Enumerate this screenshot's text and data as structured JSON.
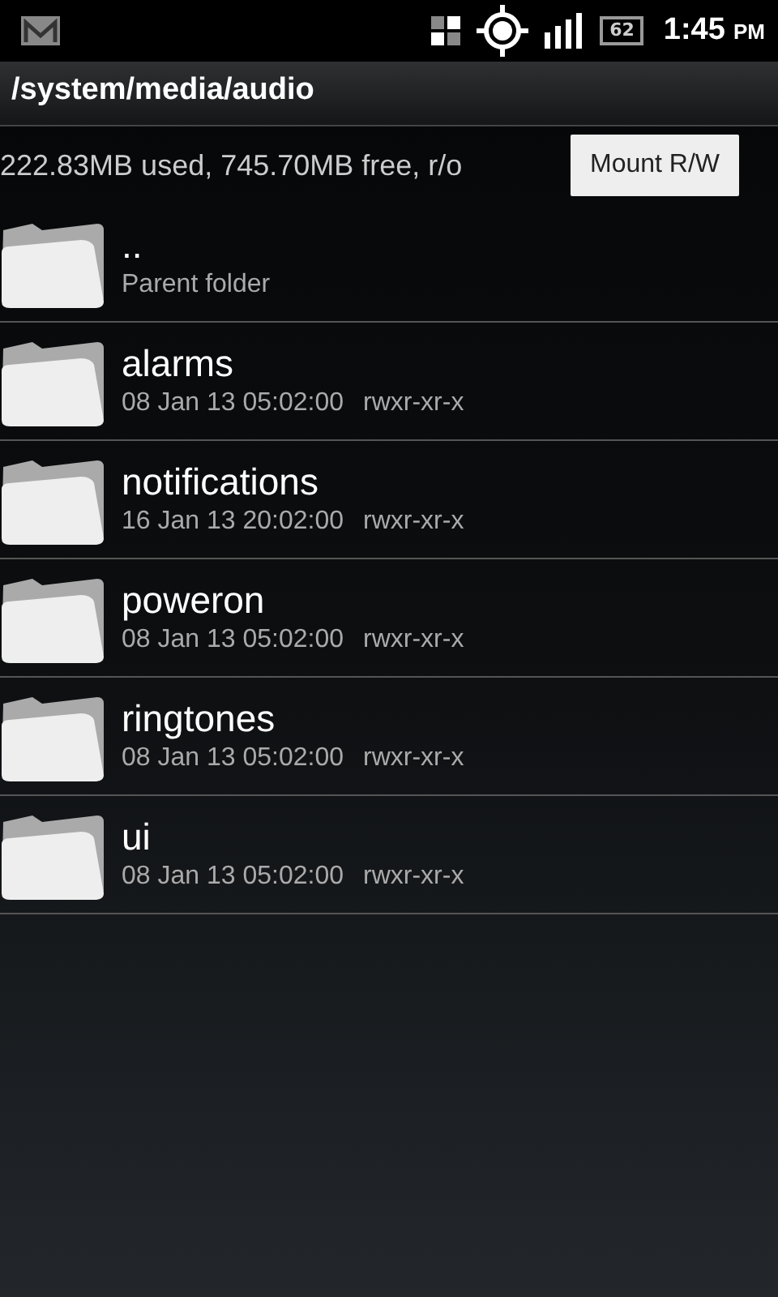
{
  "status_bar": {
    "battery": "62",
    "time": "1:45",
    "ampm": "PM"
  },
  "path_bar": {
    "title": "/system/media/audio"
  },
  "info_bar": {
    "usage": "222.83MB used, 745.70MB free, r/o",
    "button": "Mount R/W"
  },
  "files": [
    {
      "kind": "parent",
      "name": "..",
      "subtitle": "Parent folder"
    },
    {
      "kind": "folder",
      "name": "alarms",
      "date": "08 Jan 13 05:02:00",
      "permissions": "rwxr-xr-x"
    },
    {
      "kind": "folder",
      "name": "notifications",
      "date": "16 Jan 13 20:02:00",
      "permissions": "rwxr-xr-x"
    },
    {
      "kind": "folder",
      "name": "poweron",
      "date": "08 Jan 13 05:02:00",
      "permissions": "rwxr-xr-x"
    },
    {
      "kind": "folder",
      "name": "ringtones",
      "date": "08 Jan 13 05:02:00",
      "permissions": "rwxr-xr-x"
    },
    {
      "kind": "folder",
      "name": "ui",
      "date": "08 Jan 13 05:02:00",
      "permissions": "rwxr-xr-x"
    }
  ]
}
